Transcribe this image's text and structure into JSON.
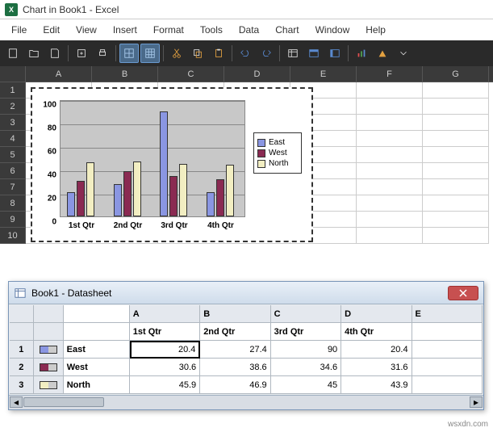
{
  "title": "Chart in Book1 - Excel",
  "menu": [
    "File",
    "Edit",
    "View",
    "Insert",
    "Format",
    "Tools",
    "Data",
    "Chart",
    "Window",
    "Help"
  ],
  "columns": [
    "A",
    "B",
    "C",
    "D",
    "E",
    "F",
    "G"
  ],
  "rows": [
    "1",
    "2",
    "3",
    "4",
    "5",
    "6",
    "7",
    "8",
    "9",
    "10"
  ],
  "chart_data": {
    "type": "bar",
    "categories": [
      "1st Qtr",
      "2nd Qtr",
      "3rd Qtr",
      "4th Qtr"
    ],
    "series": [
      {
        "name": "East",
        "color": "#8a96e2",
        "values": [
          20.4,
          27.4,
          90,
          20.4
        ]
      },
      {
        "name": "West",
        "color": "#8a2a52",
        "values": [
          30.6,
          38.6,
          34.6,
          31.6
        ]
      },
      {
        "name": "North",
        "color": "#f2eec2",
        "values": [
          45.9,
          46.9,
          45,
          43.9
        ]
      }
    ],
    "title": "",
    "xlabel": "",
    "ylabel": "",
    "ylim": [
      0,
      100
    ],
    "yticks": [
      0,
      20,
      40,
      60,
      80,
      100
    ]
  },
  "datasheet": {
    "title": "Book1 - Datasheet",
    "cols": [
      "A",
      "B",
      "C",
      "D",
      "E"
    ],
    "headers": [
      "1st Qtr",
      "2nd Qtr",
      "3rd Qtr",
      "4th Qtr"
    ],
    "rows": [
      {
        "n": "1",
        "label": "East",
        "color": "#8a96e2",
        "vals": [
          "20.4",
          "27.4",
          "90",
          "20.4"
        ]
      },
      {
        "n": "2",
        "label": "West",
        "color": "#8a2a52",
        "vals": [
          "30.6",
          "38.6",
          "34.6",
          "31.6"
        ]
      },
      {
        "n": "3",
        "label": "North",
        "color": "#f2eec2",
        "vals": [
          "45.9",
          "46.9",
          "45",
          "43.9"
        ]
      }
    ],
    "selected": {
      "row": 0,
      "col": 0
    }
  },
  "watermark": "wsxdn.com"
}
